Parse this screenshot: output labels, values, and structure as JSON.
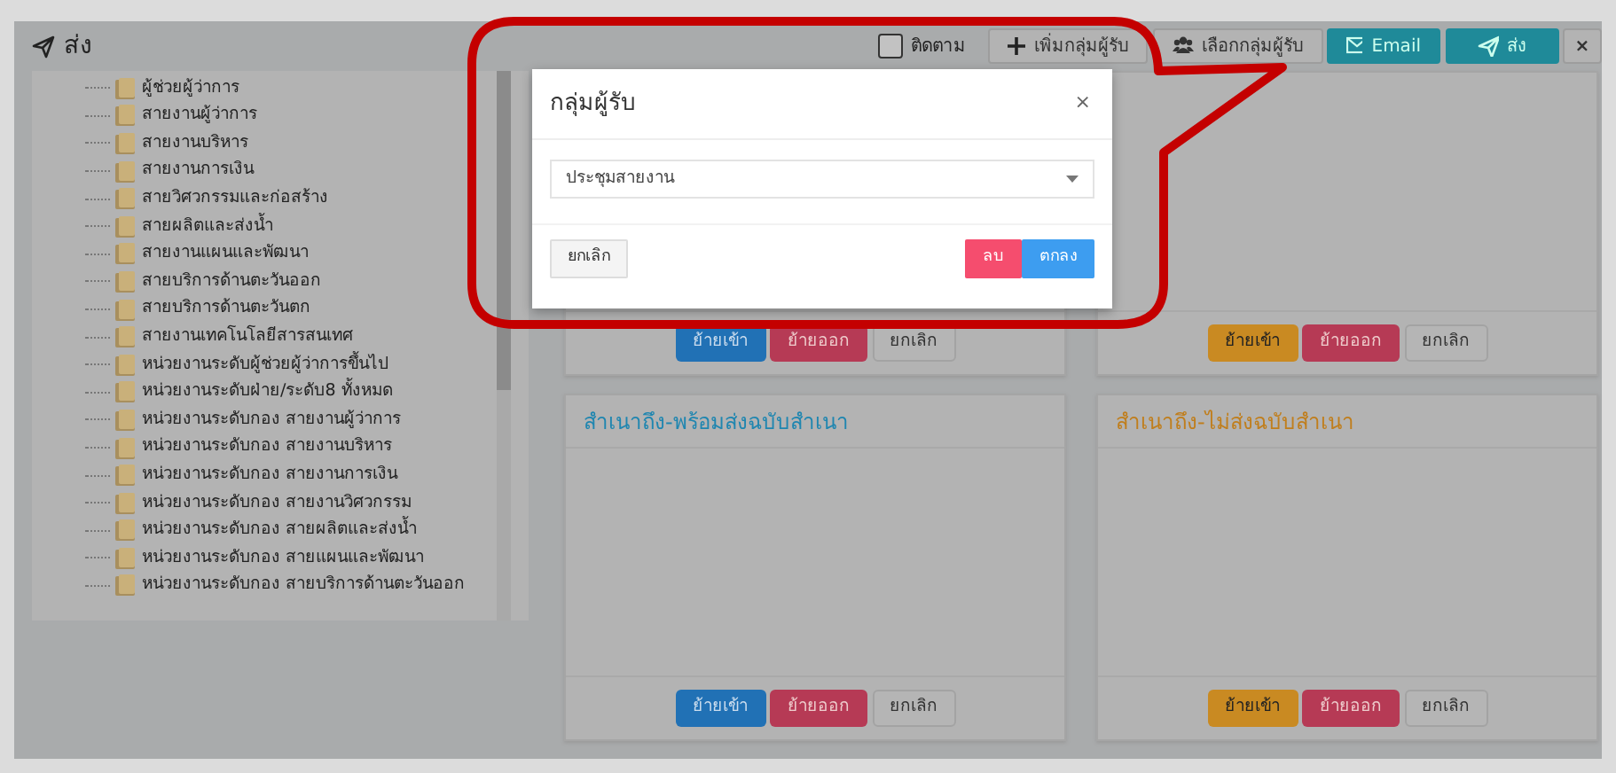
{
  "header": {
    "title": "ส่ง"
  },
  "toolbar": {
    "follow": {
      "label": "ติดตาม",
      "checked": false
    },
    "buttons": [
      {
        "label": "เพิ่มกลุ่มผู้รับ",
        "kind": "add"
      },
      {
        "label": "เลือกกลุ่มผู้รับ",
        "kind": "group"
      },
      {
        "label": "Email",
        "kind": "email"
      },
      {
        "label": "ส่ง",
        "kind": "send"
      },
      {
        "label": "×",
        "kind": "close"
      }
    ]
  },
  "tree": {
    "items": [
      {
        "label": "ผู้ช่วยผู้ว่าการ"
      },
      {
        "label": "สายงานผู้ว่าการ"
      },
      {
        "label": "สายงานบริหาร"
      },
      {
        "label": "สายงานการเงิน"
      },
      {
        "label": "สายวิศวกรรมและก่อสร้าง"
      },
      {
        "label": "สายผลิตและส่งน้ำ"
      },
      {
        "label": "สายงานแผนและพัฒนา"
      },
      {
        "label": "สายบริการด้านตะวันออก"
      },
      {
        "label": "สายบริการด้านตะวันตก"
      },
      {
        "label": "สายงานเทคโนโลยีสารสนเทศ"
      },
      {
        "label": "หน่วยงานระดับผู้ช่วยผู้ว่าการขึ้นไป"
      },
      {
        "label": "หน่วยงานระดับฝ่าย/ระดับ8 ทั้งหมด"
      },
      {
        "label": "หน่วยงานระดับกอง สายงานผู้ว่าการ"
      },
      {
        "label": "หน่วยงานระดับกอง สายงานบริหาร"
      },
      {
        "label": "หน่วยงานระดับกอง สายงานการเงิน"
      },
      {
        "label": "หน่วยงานระดับกอง สายงานวิศวกรรม"
      },
      {
        "label": "หน่วยงานระดับกอง สายผลิตและส่งน้ำ"
      },
      {
        "label": "หน่วยงานระดับกอง สายแผนและพัฒนา"
      },
      {
        "label": "หน่วยงานระดับกอง สายบริการด้านตะวันออก"
      }
    ]
  },
  "cards": [
    {
      "buttons": [
        {
          "label": "ย้ายเข้า",
          "kind": "in-blue"
        },
        {
          "label": "ย้ายออก",
          "kind": "out"
        },
        {
          "label": "ยกเลิก",
          "kind": "cancel"
        }
      ]
    },
    {
      "buttons": [
        {
          "label": "ย้ายเข้า",
          "kind": "in-yellow"
        },
        {
          "label": "ย้ายออก",
          "kind": "out"
        },
        {
          "label": "ยกเลิก",
          "kind": "cancel"
        }
      ]
    },
    {
      "title": "สำเนาถึง-พร้อมส่งฉบับสำเนา",
      "color": "#1f86b0",
      "buttons": [
        {
          "label": "ย้ายเข้า",
          "kind": "in-blue"
        },
        {
          "label": "ย้ายออก",
          "kind": "out"
        },
        {
          "label": "ยกเลิก",
          "kind": "cancel"
        }
      ]
    },
    {
      "title": "สำเนาถึง-ไม่ส่งฉบับสำเนา",
      "color": "#c07e1c",
      "buttons": [
        {
          "label": "ย้ายเข้า",
          "kind": "in-yellow"
        },
        {
          "label": "ย้ายออก",
          "kind": "out"
        },
        {
          "label": "ยกเลิก",
          "kind": "cancel"
        }
      ]
    }
  ],
  "modal": {
    "title": "กลุ่มผู้รับ",
    "close": "×",
    "select": {
      "value": "ประชุมสายงาน"
    },
    "buttons": [
      {
        "label": "ยกเลิก",
        "kind": "cancel"
      },
      {
        "label": "ลบ",
        "kind": "delete"
      },
      {
        "label": "ตกลง",
        "kind": "ok"
      }
    ]
  }
}
